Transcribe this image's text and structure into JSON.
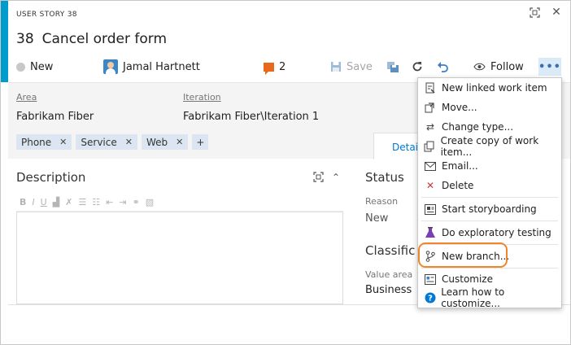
{
  "window": {
    "type_label": "USER STORY 38",
    "id": "38",
    "title": "Cancel order form"
  },
  "toolbar": {
    "state": "New",
    "assignee": "Jamal Hartnett",
    "comment_count": "2",
    "save_label": "Save",
    "follow_label": "Follow",
    "more_label": "•••"
  },
  "fields": {
    "area_label": "Area",
    "area_value": "Fabrikam Fiber",
    "iteration_label": "Iteration",
    "iteration_value": "Fabrikam Fiber\\Iteration 1"
  },
  "tags": [
    "Phone",
    "Service",
    "Web"
  ],
  "tab_details": "Detai",
  "description": {
    "title": "Description"
  },
  "status": {
    "title": "Status",
    "reason_label": "Reason",
    "reason_value": "New",
    "class_title": "Classific",
    "value_area_label": "Value area",
    "value_area_value": "Business"
  },
  "menu": {
    "items": [
      {
        "label": "New linked work item",
        "icon": "linked-work-item-icon"
      },
      {
        "label": "Move...",
        "icon": "move-icon"
      },
      {
        "label": "Change type...",
        "icon": "change-type-icon"
      },
      {
        "label": "Create copy of work item...",
        "icon": "copy-icon"
      },
      {
        "label": "Email...",
        "icon": "email-icon"
      },
      {
        "label": "Delete",
        "icon": "delete-icon"
      },
      {
        "label": "Start storyboarding",
        "icon": "storyboard-icon"
      },
      {
        "label": "Do exploratory testing",
        "icon": "flask-icon"
      },
      {
        "label": "New branch...",
        "icon": "branch-icon"
      },
      {
        "label": "Customize",
        "icon": "customize-icon"
      },
      {
        "label": "Learn how to customize...",
        "icon": "help-icon"
      }
    ]
  },
  "colors": {
    "accent": "#009ccc",
    "highlight": "#f0862c",
    "delete": "#d13438",
    "comment": "#e8691c",
    "help": "#0078d4"
  }
}
